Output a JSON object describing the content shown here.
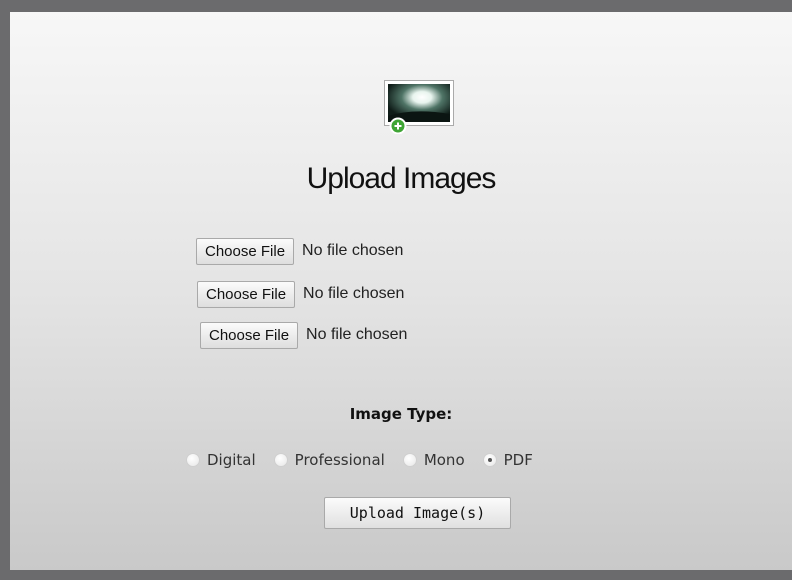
{
  "header": {
    "title": "Upload Images",
    "icon": "image-add-icon"
  },
  "file_inputs": [
    {
      "button_label": "Choose File",
      "status": "No file chosen"
    },
    {
      "button_label": "Choose File",
      "status": "No file chosen"
    },
    {
      "button_label": "Choose File",
      "status": "No file chosen"
    }
  ],
  "image_type": {
    "label": "Image Type:",
    "options": [
      {
        "label": "Digital",
        "checked": false
      },
      {
        "label": "Professional",
        "checked": false
      },
      {
        "label": "Mono",
        "checked": false
      },
      {
        "label": "PDF",
        "checked": true
      }
    ]
  },
  "submit": {
    "label": "Upload Image(s)"
  },
  "colors": {
    "frame": "#6b6b6d",
    "add_badge": "#3fa535"
  }
}
